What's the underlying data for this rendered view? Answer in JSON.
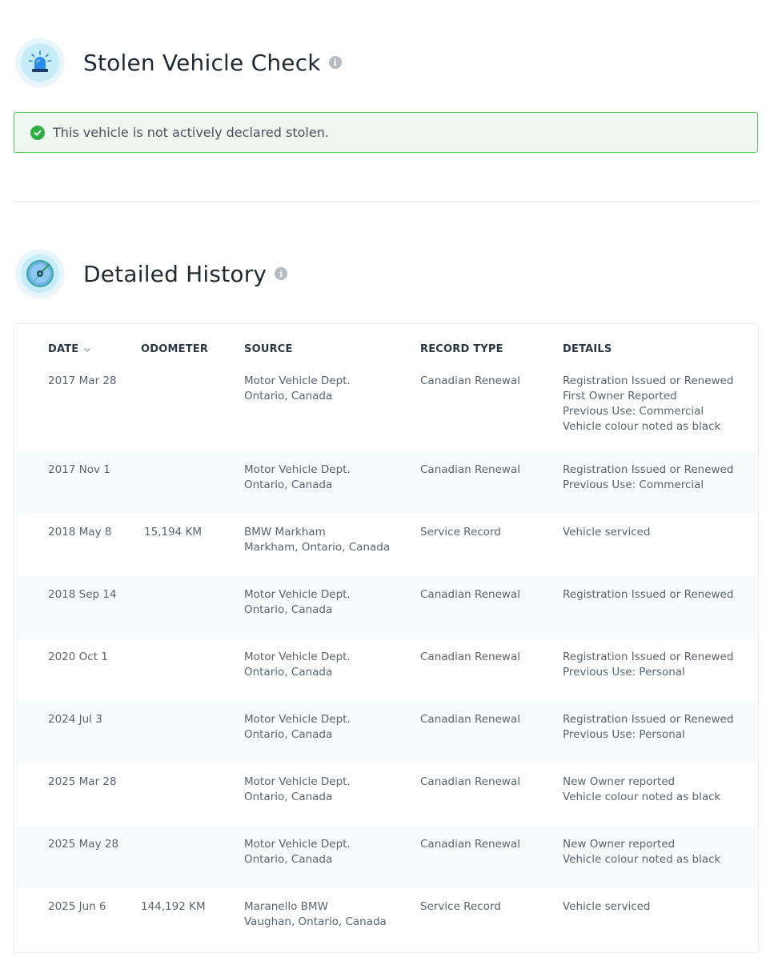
{
  "stolen": {
    "title": "Stolen Vehicle Check",
    "status_text": "This vehicle is not actively declared stolen.",
    "status_color": "#2fae46"
  },
  "history": {
    "title": "Detailed History",
    "columns": {
      "date": "DATE",
      "odometer": "ODOMETER",
      "source": "SOURCE",
      "record_type": "RECORD TYPE",
      "details": "DETAILS"
    },
    "rows": [
      {
        "date": "2017 Mar 28",
        "odometer": "",
        "source": [
          "Motor Vehicle Dept.",
          "Ontario, Canada"
        ],
        "record_type": "Canadian Renewal",
        "details": [
          "Registration Issued or Renewed",
          "First Owner Reported",
          "Previous Use: Commercial",
          "Vehicle colour noted as black"
        ]
      },
      {
        "date": "2017 Nov 1",
        "odometer": "",
        "source": [
          "Motor Vehicle Dept.",
          "Ontario, Canada"
        ],
        "record_type": "Canadian Renewal",
        "details": [
          "Registration Issued or Renewed",
          "Previous Use: Commercial"
        ]
      },
      {
        "date": "2018 May 8",
        "odometer": "15,194 KM",
        "source": [
          "BMW Markham",
          "Markham, Ontario, Canada"
        ],
        "record_type": "Service Record",
        "details": [
          "Vehicle serviced"
        ]
      },
      {
        "date": "2018 Sep 14",
        "odometer": "",
        "source": [
          "Motor Vehicle Dept.",
          "Ontario, Canada"
        ],
        "record_type": "Canadian Renewal",
        "details": [
          "Registration Issued or Renewed"
        ]
      },
      {
        "date": "2020 Oct 1",
        "odometer": "",
        "source": [
          "Motor Vehicle Dept.",
          "Ontario, Canada"
        ],
        "record_type": "Canadian Renewal",
        "details": [
          "Registration Issued or Renewed",
          "Previous Use: Personal"
        ]
      },
      {
        "date": "2024 Jul 3",
        "odometer": "",
        "source": [
          "Motor Vehicle Dept.",
          "Ontario, Canada"
        ],
        "record_type": "Canadian Renewal",
        "details": [
          "Registration Issued or Renewed",
          "Previous Use: Personal"
        ]
      },
      {
        "date": "2025 Mar 28",
        "odometer": "",
        "source": [
          "Motor Vehicle Dept.",
          "Ontario, Canada"
        ],
        "record_type": "Canadian Renewal",
        "details": [
          "New Owner reported",
          "Vehicle colour noted as black"
        ]
      },
      {
        "date": "2025 May 28",
        "odometer": "",
        "source": [
          "Motor Vehicle Dept.",
          "Ontario, Canada"
        ],
        "record_type": "Canadian Renewal",
        "details": [
          "New Owner reported",
          "Vehicle colour noted as black"
        ]
      },
      {
        "date": "2025 Jun 6",
        "odometer": "144,192 KM",
        "source": [
          "Maranello BMW",
          "Vaughan, Ontario, Canada"
        ],
        "record_type": "Service Record",
        "details": [
          "Vehicle serviced"
        ]
      }
    ]
  }
}
